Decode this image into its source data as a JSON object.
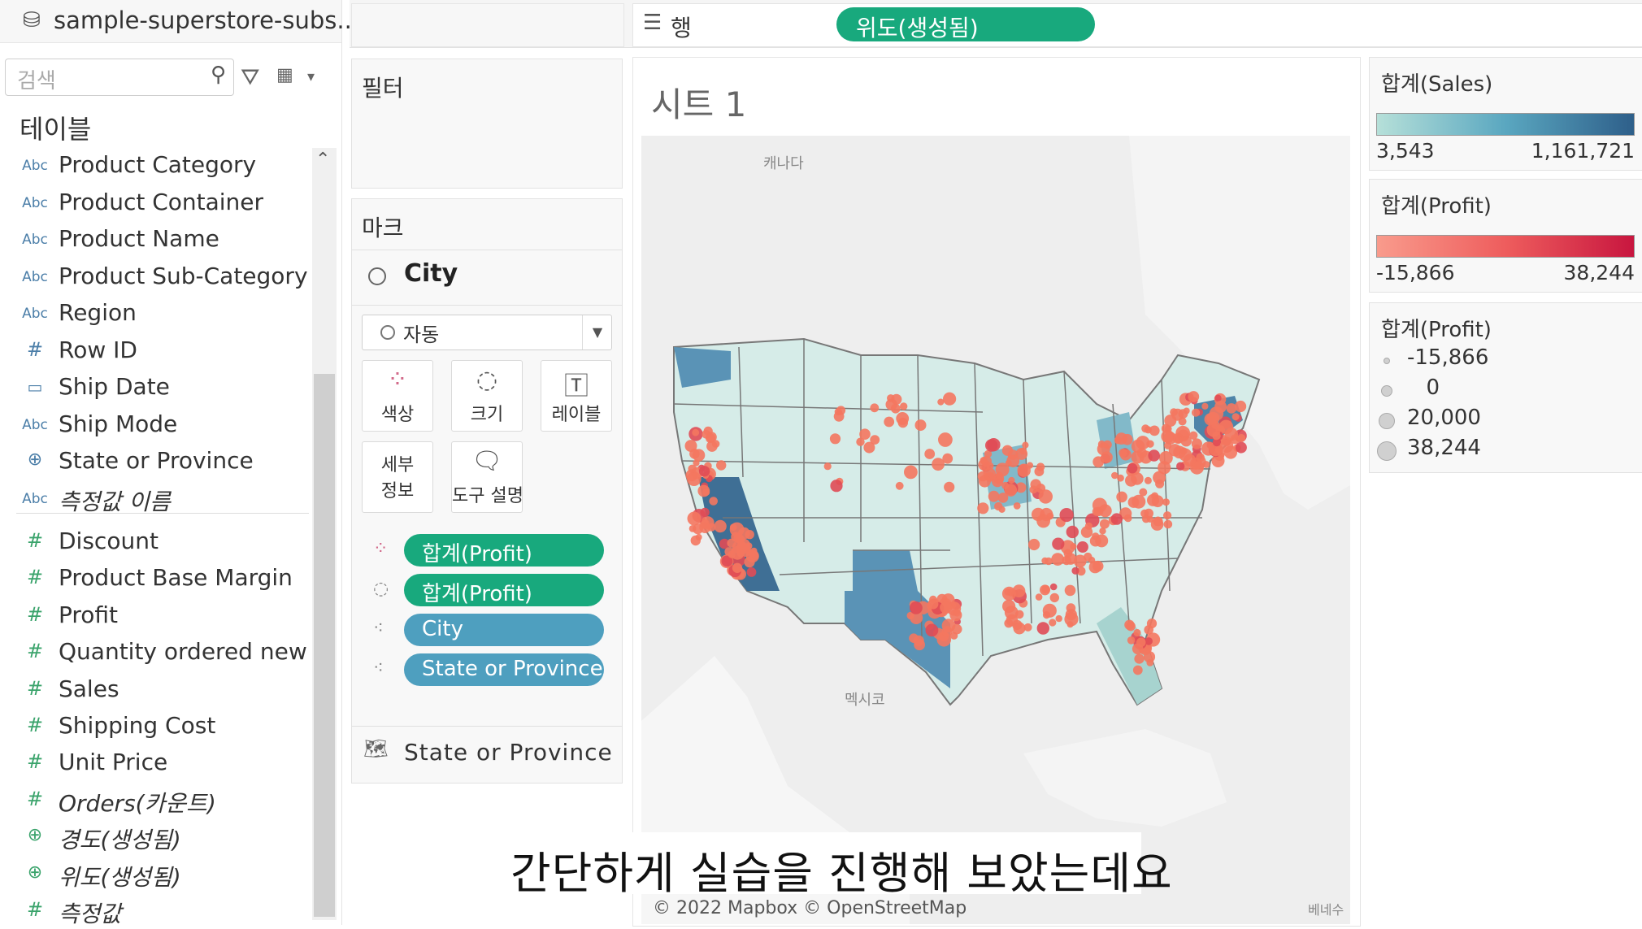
{
  "datasource": {
    "title": "sample-superstore-subs..."
  },
  "search": {
    "placeholder": "검색"
  },
  "tables_label": "테이블",
  "dimensions": [
    {
      "type": "abc",
      "label": "Product Category"
    },
    {
      "type": "abc",
      "label": "Product Container"
    },
    {
      "type": "abc",
      "label": "Product Name"
    },
    {
      "type": "abc",
      "label": "Product Sub-Category"
    },
    {
      "type": "abc",
      "label": "Region"
    },
    {
      "type": "hash-blue",
      "label": "Row ID"
    },
    {
      "type": "calendar",
      "label": "Ship Date"
    },
    {
      "type": "abc",
      "label": "Ship Mode"
    },
    {
      "type": "globe-blue",
      "label": "State or Province"
    },
    {
      "type": "abc",
      "label": "측정값 이름",
      "italic": true
    }
  ],
  "measures": [
    {
      "type": "hash",
      "label": "Discount"
    },
    {
      "type": "hash",
      "label": "Product Base Margin"
    },
    {
      "type": "hash",
      "label": "Profit"
    },
    {
      "type": "hash",
      "label": "Quantity ordered new"
    },
    {
      "type": "hash",
      "label": "Sales"
    },
    {
      "type": "hash",
      "label": "Shipping Cost"
    },
    {
      "type": "hash",
      "label": "Unit Price"
    },
    {
      "type": "hash",
      "label": "Orders(카운트)",
      "italic": true
    },
    {
      "type": "globe",
      "label": "경도(생성됨)",
      "italic": true
    },
    {
      "type": "globe",
      "label": "위도(생성됨)",
      "italic": true
    },
    {
      "type": "hash",
      "label": "측정값",
      "italic": true
    }
  ],
  "rows_shelf": {
    "label": "행",
    "pill": "위도(생성됨)"
  },
  "filters": {
    "title": "필터"
  },
  "marks": {
    "title": "마크",
    "sheet_layer": "City",
    "mark_type": "자동",
    "buttons": {
      "color": "색상",
      "size": "크기",
      "label": "레이블",
      "detail_1": "세부",
      "detail_2": "정보",
      "tooltip": "도구 설명"
    },
    "pills": [
      {
        "role": "color",
        "label": "합계(Profit)",
        "color": "#18a97d"
      },
      {
        "role": "size",
        "label": "합계(Profit)",
        "color": "#18a97d"
      },
      {
        "role": "detail",
        "label": "City",
        "color": "#4e9fbf"
      },
      {
        "role": "detail",
        "label": "State or Province",
        "color": "#4e9fbf"
      }
    ],
    "geo_layer": "State or Province"
  },
  "view": {
    "sheet_title": "시트 1",
    "map_labels": {
      "canada": "캐나다",
      "mexico": "멕시코",
      "venezuela": "베네수"
    },
    "attribution": "© 2022 Mapbox © OpenStreetMap"
  },
  "legends": {
    "sales_color": {
      "title": "합계(Sales)",
      "min": "3,543",
      "max": "1,161,721",
      "from": "#b6e0d9",
      "to": "#2e5f8a"
    },
    "profit_color": {
      "title": "합계(Profit)",
      "min": "-15,866",
      "max": "38,244",
      "from": "#f99b8c",
      "to": "#c8163f"
    },
    "profit_size": {
      "title": "합계(Profit)",
      "items": [
        "-15,866",
        "0",
        "20,000",
        "38,244"
      ]
    }
  },
  "subtitle": "간단하게 실습을 진행해 보았는데요"
}
